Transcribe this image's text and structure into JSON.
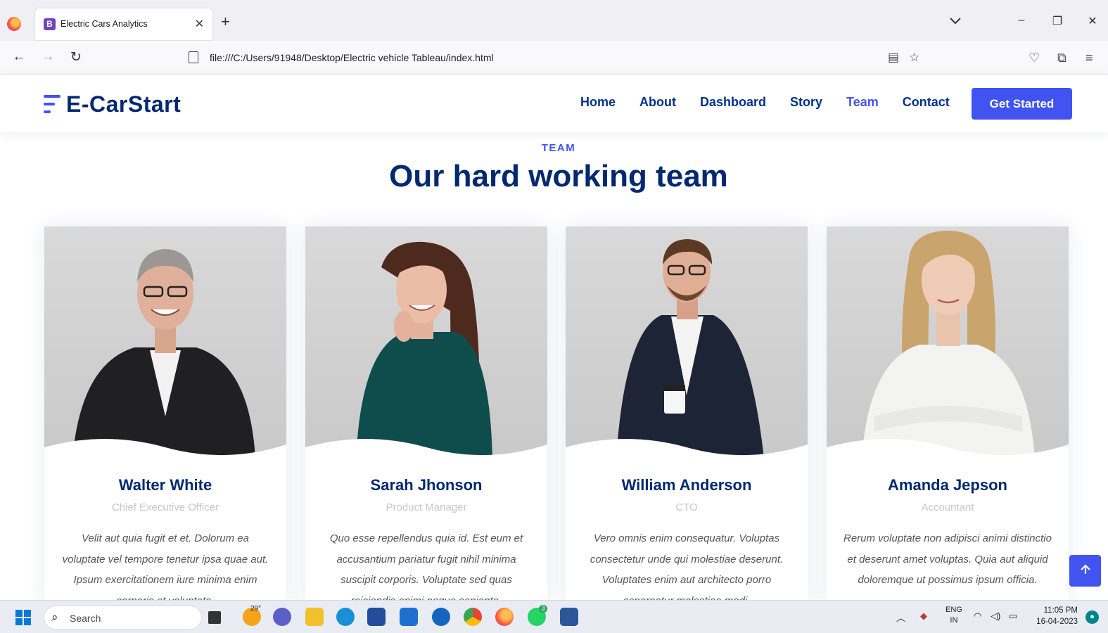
{
  "browser": {
    "tab_title": "Electric Cars Analytics",
    "tab_favicon": "B",
    "url": "file:///C:/Users/91948/Desktop/Electric vehicle Tableau/index.html"
  },
  "header": {
    "logo_text": "E-CarStart",
    "menu": [
      "Home",
      "About",
      "Dashboard",
      "Story",
      "Team",
      "Contact"
    ],
    "active_menu": "Team",
    "cta": "Get Started"
  },
  "team": {
    "tag": "TEAM",
    "title": "Our hard working team",
    "members": [
      {
        "name": "Walter White",
        "role": "Chief Executive Officer",
        "bio": "Velit aut quia fugit et et. Dolorum ea voluptate vel tempore tenetur ipsa quae aut. Ipsum exercitationem iure minima enim corporis et voluptate."
      },
      {
        "name": "Sarah Jhonson",
        "role": "Product Manager",
        "bio": "Quo esse repellendus quia id. Est eum et accusantium pariatur fugit nihil minima suscipit corporis. Voluptate sed quas reiciendis animi neque sapiente."
      },
      {
        "name": "William Anderson",
        "role": "CTO",
        "bio": "Vero omnis enim consequatur. Voluptas consectetur unde qui molestiae deserunt. Voluptates enim aut architecto porro aspernatur molestiae modi."
      },
      {
        "name": "Amanda Jepson",
        "role": "Accountant",
        "bio": "Rerum voluptate non adipisci animi distinctio et deserunt amet voluptas. Quia aut aliquid doloremque ut possimus ipsum officia."
      }
    ]
  },
  "taskbar": {
    "search_placeholder": "Search",
    "weather_temp": "29°",
    "lang_line1": "ENG",
    "lang_line2": "IN",
    "time": "11:05 PM",
    "date": "16-04-2023",
    "whatsapp_badge": "3"
  },
  "colors": {
    "accent": "#4154f1",
    "navy": "#012970"
  }
}
